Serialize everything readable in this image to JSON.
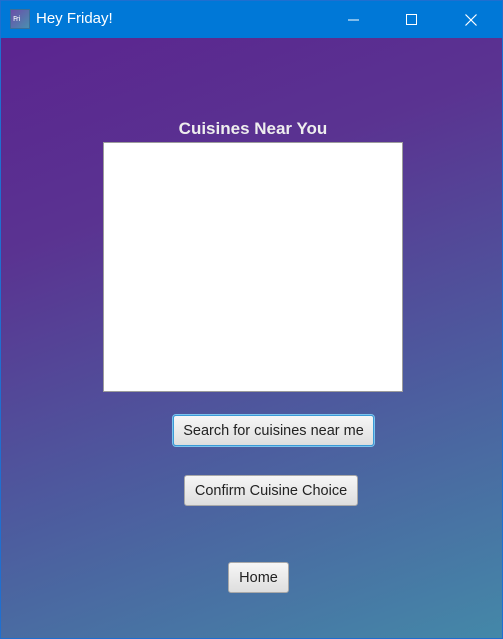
{
  "window": {
    "title": "Hey Friday!",
    "app_icon_text": "Fri"
  },
  "main": {
    "heading": "Cuisines Near You",
    "cuisine_list": [],
    "buttons": {
      "search_label": "Search for cuisines near me",
      "confirm_label": "Confirm Cuisine Choice",
      "home_label": "Home"
    }
  },
  "colors": {
    "titlebar": "#0078d7",
    "background_top": "#5b2590",
    "background_bottom": "#4488a8"
  }
}
